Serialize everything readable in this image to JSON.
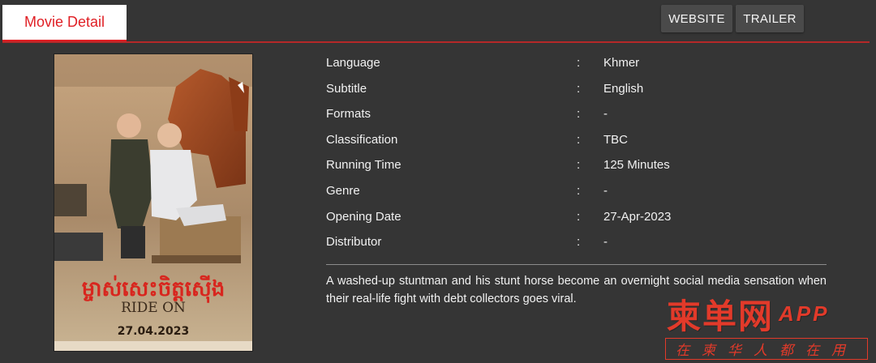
{
  "tabs": {
    "active_label": "Movie Detail"
  },
  "buttons": {
    "website": "WEBSITE",
    "trailer": "TRAILER"
  },
  "poster": {
    "khmer_title": "ម្ចាស់សេះចិត្តស៊ើង",
    "english_title": "RIDE ON",
    "date": "27.04.2023"
  },
  "details": [
    {
      "label": "Language",
      "value": "Khmer"
    },
    {
      "label": "Subtitle",
      "value": "English"
    },
    {
      "label": "Formats",
      "value": "-"
    },
    {
      "label": "Classification",
      "value": "TBC"
    },
    {
      "label": "Running Time",
      "value": "125 Minutes"
    },
    {
      "label": "Genre",
      "value": "-"
    },
    {
      "label": "Opening Date",
      "value": "27-Apr-2023"
    },
    {
      "label": "Distributor",
      "value": "-"
    }
  ],
  "separator": ":",
  "synopsis": "A washed-up stuntman and his stunt horse become an overnight social media sensation when their real-life fight with debt collectors goes viral.",
  "watermark": {
    "brand": "柬单网",
    "app": "APP",
    "tagline": "在柬华人都在用"
  }
}
